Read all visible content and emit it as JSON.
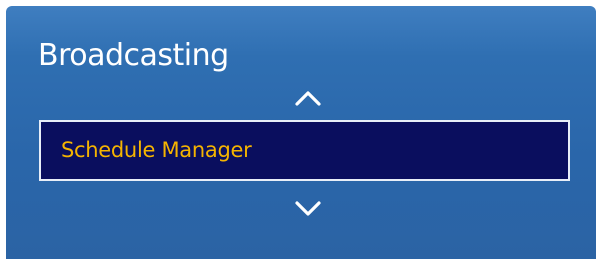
{
  "menu": {
    "title": "Broadcasting",
    "selected_item": "Schedule Manager",
    "scroll_up_icon": "chevron-up-icon",
    "scroll_down_icon": "chevron-down-icon"
  },
  "colors": {
    "panel_background": "#2b68ac",
    "title_text": "#ffffff",
    "selected_background": "#0a0e5e",
    "selected_border": "#e8eef8",
    "selected_text": "#f5b400",
    "arrow": "#ffffff"
  }
}
